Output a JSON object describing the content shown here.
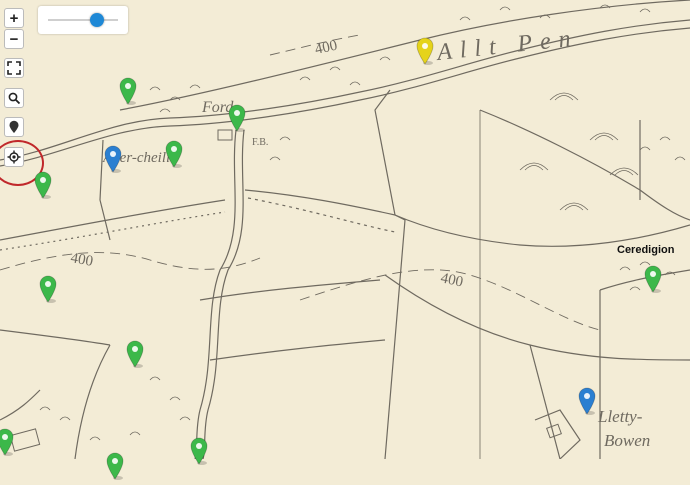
{
  "controls": {
    "zoom_in": "+",
    "zoom_out": "−",
    "fullscreen_icon": "fullscreen-icon",
    "search_icon": "search-icon",
    "marker_icon": "map-marker-icon",
    "locate_icon": "locate-icon"
  },
  "opacity_slider": {
    "value": 0.7
  },
  "map_labels": {
    "allt_pen": "Allt Pen",
    "ford": "Ford",
    "fb": "F.B.",
    "aber_cheilit": "Aber-cheilit",
    "elev_400_a": "400",
    "elev_400_b": "400",
    "elev_400_c": "400",
    "lletty": "Lletty-",
    "bowen": "Bowen"
  },
  "region_label": "Ceredigion",
  "colors": {
    "map_paper": "#f3ecd6",
    "ink": "#6f6a60",
    "marker_green": "#3cb84a",
    "marker_blue": "#2b7fd1",
    "marker_yellow": "#e5d31a",
    "locate_ring": "#c0282b"
  },
  "markers": [
    {
      "color": "green",
      "title": "green marker"
    },
    {
      "color": "green",
      "title": "green marker"
    },
    {
      "color": "green",
      "title": "green marker"
    },
    {
      "color": "blue",
      "title": "blue marker"
    },
    {
      "color": "green",
      "title": "green marker"
    },
    {
      "color": "yellow",
      "title": "yellow marker"
    },
    {
      "color": "green",
      "title": "green marker"
    },
    {
      "color": "green",
      "title": "green marker"
    },
    {
      "color": "green",
      "title": "green marker"
    },
    {
      "color": "blue",
      "title": "blue marker"
    },
    {
      "color": "green",
      "title": "green marker"
    },
    {
      "color": "green",
      "title": "green marker"
    },
    {
      "color": "green",
      "title": "green marker"
    }
  ]
}
